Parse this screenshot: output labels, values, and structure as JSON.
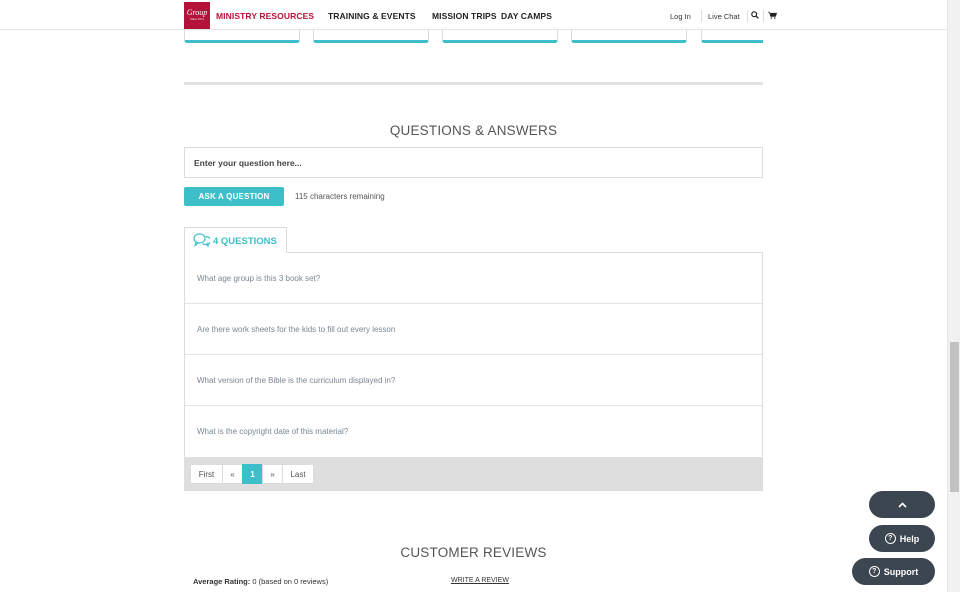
{
  "nav": {
    "logo_text": "Group",
    "logo_sub": "Since 1974",
    "items": [
      "MINISTRY RESOURCES",
      "TRAINING & EVENTS",
      "MISSION TRIPS",
      "DAY CAMPS"
    ],
    "login": "Log In",
    "live_chat": "Live Chat"
  },
  "qa": {
    "title": "QUESTIONS & ANSWERS",
    "input_placeholder": "Enter your question here...",
    "ask_button": "ASK A QUESTION",
    "chars_remaining": "115 characters remaining",
    "tab_label": "4 QUESTIONS",
    "questions": [
      "What age group is this 3 book set?",
      "Are there work sheets for the kids to fill out every lesson",
      "What version of the Bible is the curriculum displayed in?",
      "What is the copyright date of this material?"
    ],
    "pager": {
      "first": "First",
      "prev": "«",
      "current": "1",
      "next": "»",
      "last": "Last"
    }
  },
  "reviews": {
    "title": "CUSTOMER REVIEWS",
    "avg_label": "Average Rating:",
    "avg_value": "0 (based on 0 reviews)",
    "write_link": "WRITE A REVIEW"
  },
  "floating": {
    "up_icon": "chevron-up-icon",
    "help": "Help",
    "support": "Support"
  },
  "colors": {
    "accent": "#3dbfca",
    "brand": "#b5123a",
    "dark_button": "#3c4650"
  }
}
